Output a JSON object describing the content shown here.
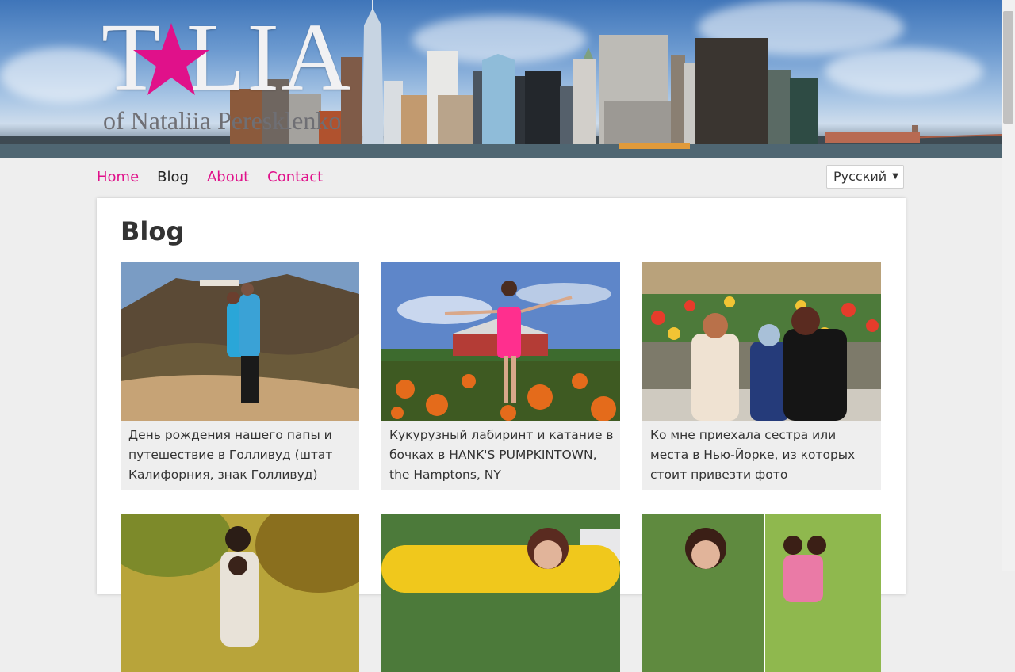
{
  "brand": {
    "logo_title": "T LIA",
    "logo_subtitle": "of Nataliia Peresklenko",
    "accent_color": "#e0118a"
  },
  "nav": {
    "items": [
      {
        "label": "Home",
        "active": false
      },
      {
        "label": "Blog",
        "active": true
      },
      {
        "label": "About",
        "active": false
      },
      {
        "label": "Contact",
        "active": false
      }
    ]
  },
  "language_select": {
    "selected": "Русский"
  },
  "page": {
    "title": "Blog"
  },
  "posts": [
    {
      "title": "День рождения нашего папы и путешествие в Голливуд (штат Калифорния, знак Голливуд)",
      "image": "couple-hollywood-sign-photo"
    },
    {
      "title": "Кукурузный лабиринт и катание в бочках в HANK'S PUMPKINTOWN, the Hamptons, NY",
      "image": "woman-pumpkin-field-photo"
    },
    {
      "title": "Ко мне приехала сестра или места в Нью-Йорке, из которых стоит привезти фото",
      "image": "family-flower-garden-photo"
    },
    {
      "title": "",
      "image": "couple-park-photo"
    },
    {
      "title": "",
      "image": "woman-yellow-car-photo"
    },
    {
      "title": "",
      "image": "two-women-collage-photo"
    }
  ]
}
